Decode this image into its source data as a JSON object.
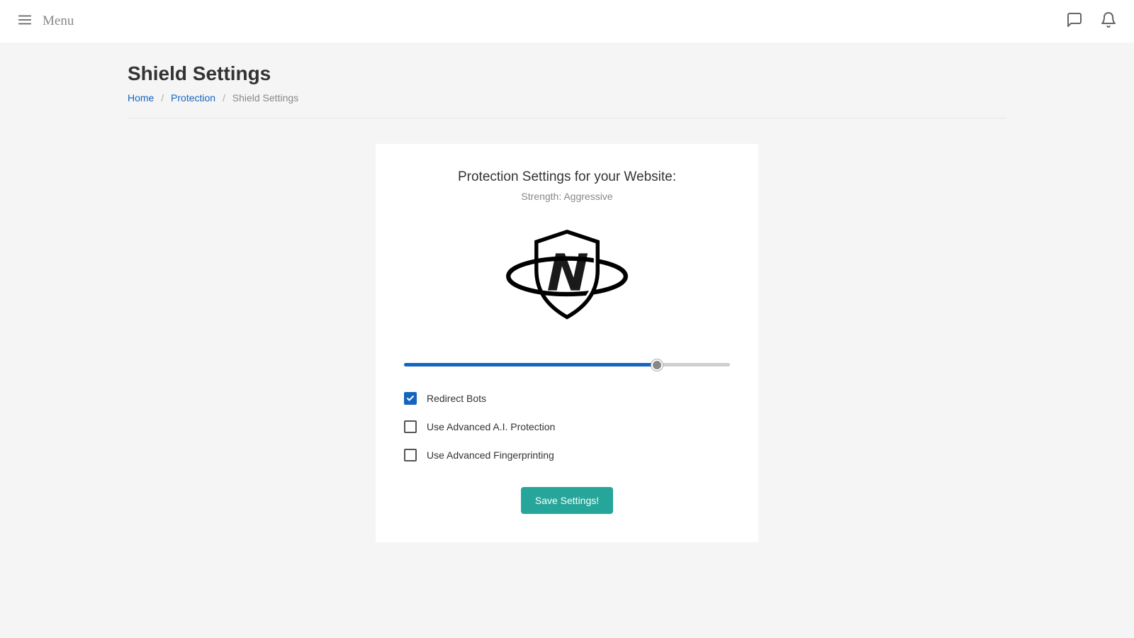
{
  "topbar": {
    "menu_label": "Menu"
  },
  "page": {
    "title": "Shield Settings"
  },
  "breadcrumb": {
    "home": "Home",
    "protection": "Protection",
    "current": "Shield Settings"
  },
  "card": {
    "title": "Protection Settings for your Website:",
    "subtitle": "Strength: Aggressive",
    "slider_percent": 77.5,
    "checkboxes": {
      "redirect_bots": {
        "label": "Redirect Bots",
        "checked": true
      },
      "ai_protection": {
        "label": "Use Advanced A.I. Protection",
        "checked": false
      },
      "fingerprinting": {
        "label": "Use Advanced Fingerprinting",
        "checked": false
      }
    },
    "save_label": "Save Settings!"
  }
}
